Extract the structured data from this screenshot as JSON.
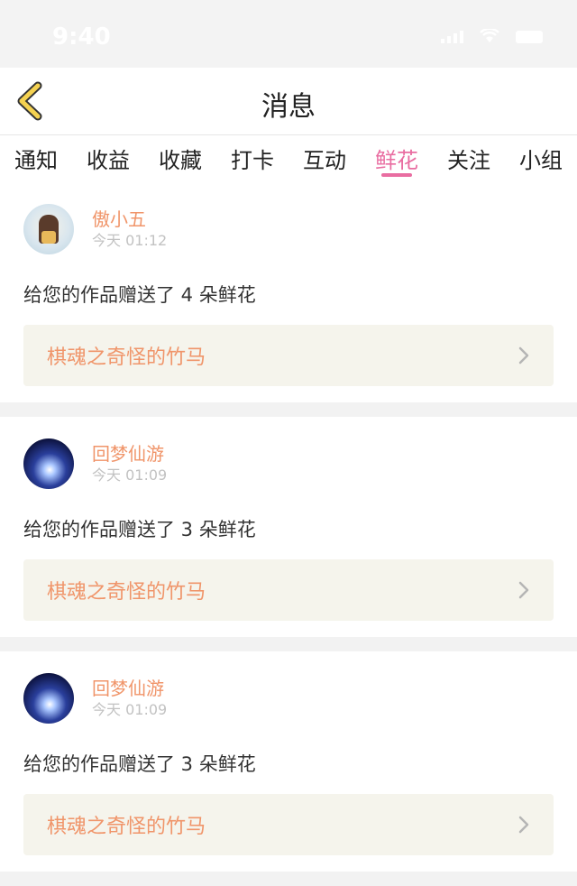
{
  "status_bar": {
    "time": "9:40"
  },
  "header": {
    "title": "消息"
  },
  "tabs": [
    {
      "label": "通知"
    },
    {
      "label": "收益"
    },
    {
      "label": "收藏"
    },
    {
      "label": "打卡"
    },
    {
      "label": "互动"
    },
    {
      "label": "鲜花",
      "active": true
    },
    {
      "label": "关注"
    },
    {
      "label": "小组"
    }
  ],
  "accent_colors": {
    "active_tab": "#e96da1",
    "username": "#f0956a",
    "back_icon": "#f5d251"
  },
  "messages": [
    {
      "user": "傲小五",
      "time": "今天 01:12",
      "text": "给您的作品赠送了 4 朵鲜花",
      "work": "棋魂之奇怪的竹马"
    },
    {
      "user": "回梦仙游",
      "time": "今天 01:09",
      "text": "给您的作品赠送了 3 朵鲜花",
      "work": "棋魂之奇怪的竹马"
    },
    {
      "user": "回梦仙游",
      "time": "今天 01:09",
      "text": "给您的作品赠送了 3 朵鲜花",
      "work": "棋魂之奇怪的竹马"
    }
  ]
}
